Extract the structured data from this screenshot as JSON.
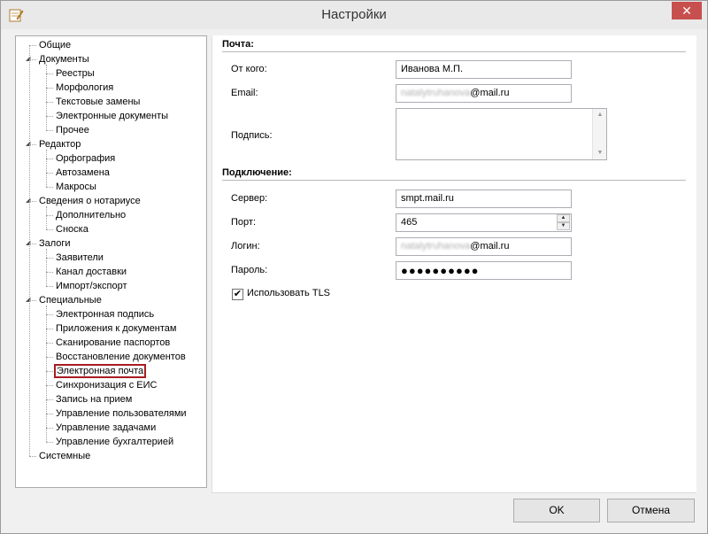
{
  "window": {
    "title": "Настройки",
    "close_glyph": "✕"
  },
  "tree": {
    "items": [
      {
        "label": "Общие",
        "level": 0,
        "expanded": false
      },
      {
        "label": "Документы",
        "level": 0,
        "expanded": true
      },
      {
        "label": "Реестры",
        "level": 1
      },
      {
        "label": "Морфология",
        "level": 1
      },
      {
        "label": "Текстовые замены",
        "level": 1
      },
      {
        "label": "Электронные документы",
        "level": 1
      },
      {
        "label": "Прочее",
        "level": 1
      },
      {
        "label": "Редактор",
        "level": 0,
        "expanded": true
      },
      {
        "label": "Орфография",
        "level": 1
      },
      {
        "label": "Автозамена",
        "level": 1
      },
      {
        "label": "Макросы",
        "level": 1
      },
      {
        "label": "Сведения о нотариусе",
        "level": 0,
        "expanded": true
      },
      {
        "label": "Дополнительно",
        "level": 1
      },
      {
        "label": "Сноска",
        "level": 1
      },
      {
        "label": "Залоги",
        "level": 0,
        "expanded": true
      },
      {
        "label": "Заявители",
        "level": 1
      },
      {
        "label": "Канал доставки",
        "level": 1
      },
      {
        "label": "Импорт/экспорт",
        "level": 1
      },
      {
        "label": "Специальные",
        "level": 0,
        "expanded": true
      },
      {
        "label": "Электронная подпись",
        "level": 1
      },
      {
        "label": "Приложения к документам",
        "level": 1
      },
      {
        "label": "Сканирование паспортов",
        "level": 1
      },
      {
        "label": "Восстановление документов",
        "level": 1
      },
      {
        "label": "Электронная почта",
        "level": 1,
        "selected": true
      },
      {
        "label": "Синхронизация с ЕИС",
        "level": 1
      },
      {
        "label": "Запись на прием",
        "level": 1
      },
      {
        "label": "Управление пользователями",
        "level": 1
      },
      {
        "label": "Управление задачами",
        "level": 1
      },
      {
        "label": "Управление бухгалтерией",
        "level": 1
      },
      {
        "label": "Системные",
        "level": 0,
        "expanded": false
      }
    ]
  },
  "mail": {
    "section_title": "Почта:",
    "from_label": "От кого:",
    "from_value": "Иванова М.П.",
    "email_label": "Email:",
    "email_blurred": "natalytruhanova",
    "email_domain": "@mail.ru",
    "signature_label": "Подпись:",
    "signature_value": ""
  },
  "connection": {
    "section_title": "Подключение:",
    "server_label": "Сервер:",
    "server_value": "smpt.mail.ru",
    "port_label": "Порт:",
    "port_value": "465",
    "login_label": "Логин:",
    "login_blurred": "natalytruhanova",
    "login_domain": "@mail.ru",
    "password_label": "Пароль:",
    "password_mask": "●●●●●●●●●●",
    "tls_label": "Использовать TLS",
    "tls_checked": true,
    "check_glyph": "✔"
  },
  "buttons": {
    "ok": "OK",
    "cancel": "Отмена"
  },
  "colors": {
    "selection_border": "#a71d22",
    "close_button": "#c7504e"
  }
}
